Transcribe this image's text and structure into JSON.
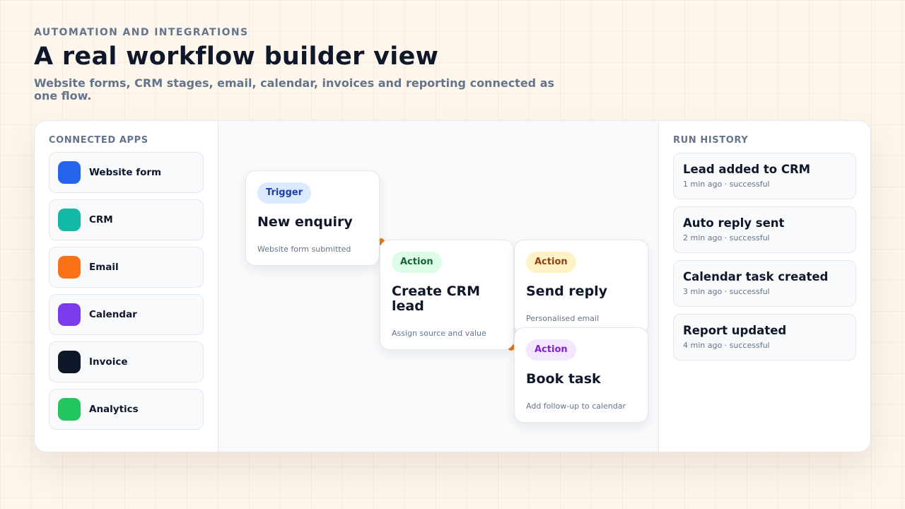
{
  "header": {
    "eyebrow": "AUTOMATION AND INTEGRATIONS",
    "title": "A real workflow builder view",
    "subtitle": "Website forms, CRM stages, email, calendar, invoices and reporting connected as one flow."
  },
  "connected_apps": {
    "heading": "CONNECTED APPS",
    "items": [
      {
        "label": "Website form",
        "color": "#2563eb"
      },
      {
        "label": "CRM",
        "color": "#14b8a6"
      },
      {
        "label": "Email",
        "color": "#f97316"
      },
      {
        "label": "Calendar",
        "color": "#7c3aed"
      },
      {
        "label": "Invoice",
        "color": "#0f172a"
      },
      {
        "label": "Analytics",
        "color": "#22c55e"
      }
    ]
  },
  "workflow": {
    "connector_color": "#ea7a1a",
    "nodes": [
      {
        "type": "Trigger",
        "title": "New enquiry",
        "description": "Website form submitted"
      },
      {
        "type": "Action",
        "title": "Create CRM lead",
        "description": "Assign source and value"
      },
      {
        "type": "Action",
        "title": "Send reply",
        "description": "Personalised email"
      },
      {
        "type": "Action",
        "title": "Book task",
        "description": "Add follow-up to calendar"
      }
    ]
  },
  "run_history": {
    "heading": "RUN HISTORY",
    "items": [
      {
        "title": "Lead added to CRM",
        "meta": "1 min ago · successful"
      },
      {
        "title": "Auto reply sent",
        "meta": "2 min ago · successful"
      },
      {
        "title": "Calendar task created",
        "meta": "3 min ago · successful"
      },
      {
        "title": "Report updated",
        "meta": "4 min ago · successful"
      }
    ]
  }
}
